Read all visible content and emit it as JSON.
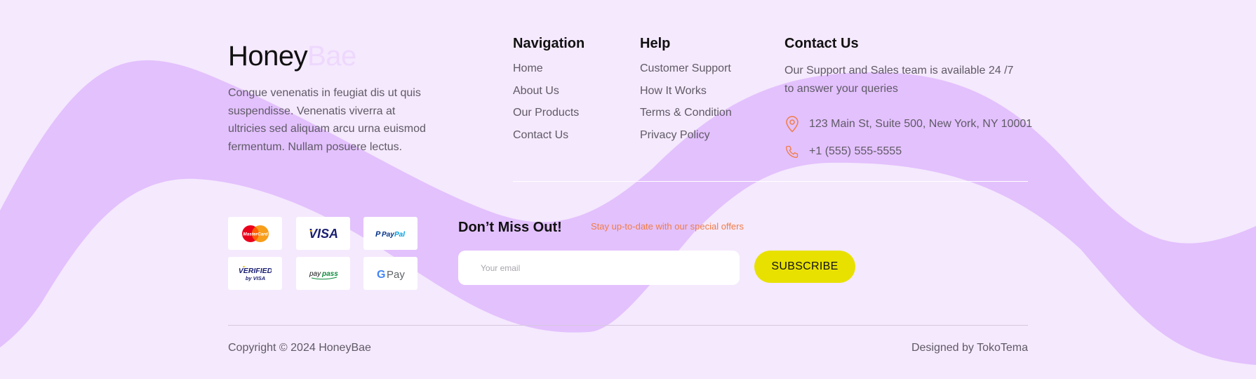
{
  "brand": {
    "name_part1": "Honey",
    "name_part2": "Bae",
    "description": "Congue venenatis in feugiat dis ut quis suspendisse. Venenatis viverra at ultricies sed aliquam arcu urna euismod fermentum. Nullam posuere lectus."
  },
  "navigation": {
    "title": "Navigation",
    "items": [
      "Home",
      "About Us",
      "Our Products",
      "Contact Us"
    ]
  },
  "help": {
    "title": "Help",
    "items": [
      "Customer Support",
      "How It Works",
      "Terms & Condition",
      "Privacy Policy"
    ]
  },
  "contact": {
    "title": "Contact Us",
    "description": "Our Support and Sales team is available 24 /7 to answer your queries",
    "address": "123 Main St, Suite 500, New York, NY 10001",
    "phone": "+1 (555) 555-5555",
    "address_icon": "map-pin-icon",
    "phone_icon": "phone-icon"
  },
  "payments": [
    {
      "name": "MasterCard",
      "icon": "mastercard-logo"
    },
    {
      "name": "VISA",
      "icon": "visa-logo"
    },
    {
      "name": "PayPal",
      "icon": "paypal-logo"
    },
    {
      "name": "VERIFIED by VISA",
      "icon": "verified-by-visa-logo"
    },
    {
      "name": "paypass",
      "icon": "paypass-logo"
    },
    {
      "name": "G Pay",
      "icon": "google-pay-logo"
    }
  ],
  "newsletter": {
    "title": "Don’t Miss Out!",
    "subtitle": "Stay up-to-date with our special offers",
    "email_placeholder": "Your email",
    "email_value": "",
    "button_label": "SUBSCRIBE"
  },
  "footer": {
    "copyright": "Copyright © 2024 HoneyBae",
    "designed_by": "Designed by TokoTema"
  },
  "colors": {
    "background": "#f5e9fd",
    "wave": "#e3c1fd",
    "accent_orange": "#f07c45",
    "button_yellow": "#e8e100",
    "logo_accent": "#eed8fd"
  }
}
